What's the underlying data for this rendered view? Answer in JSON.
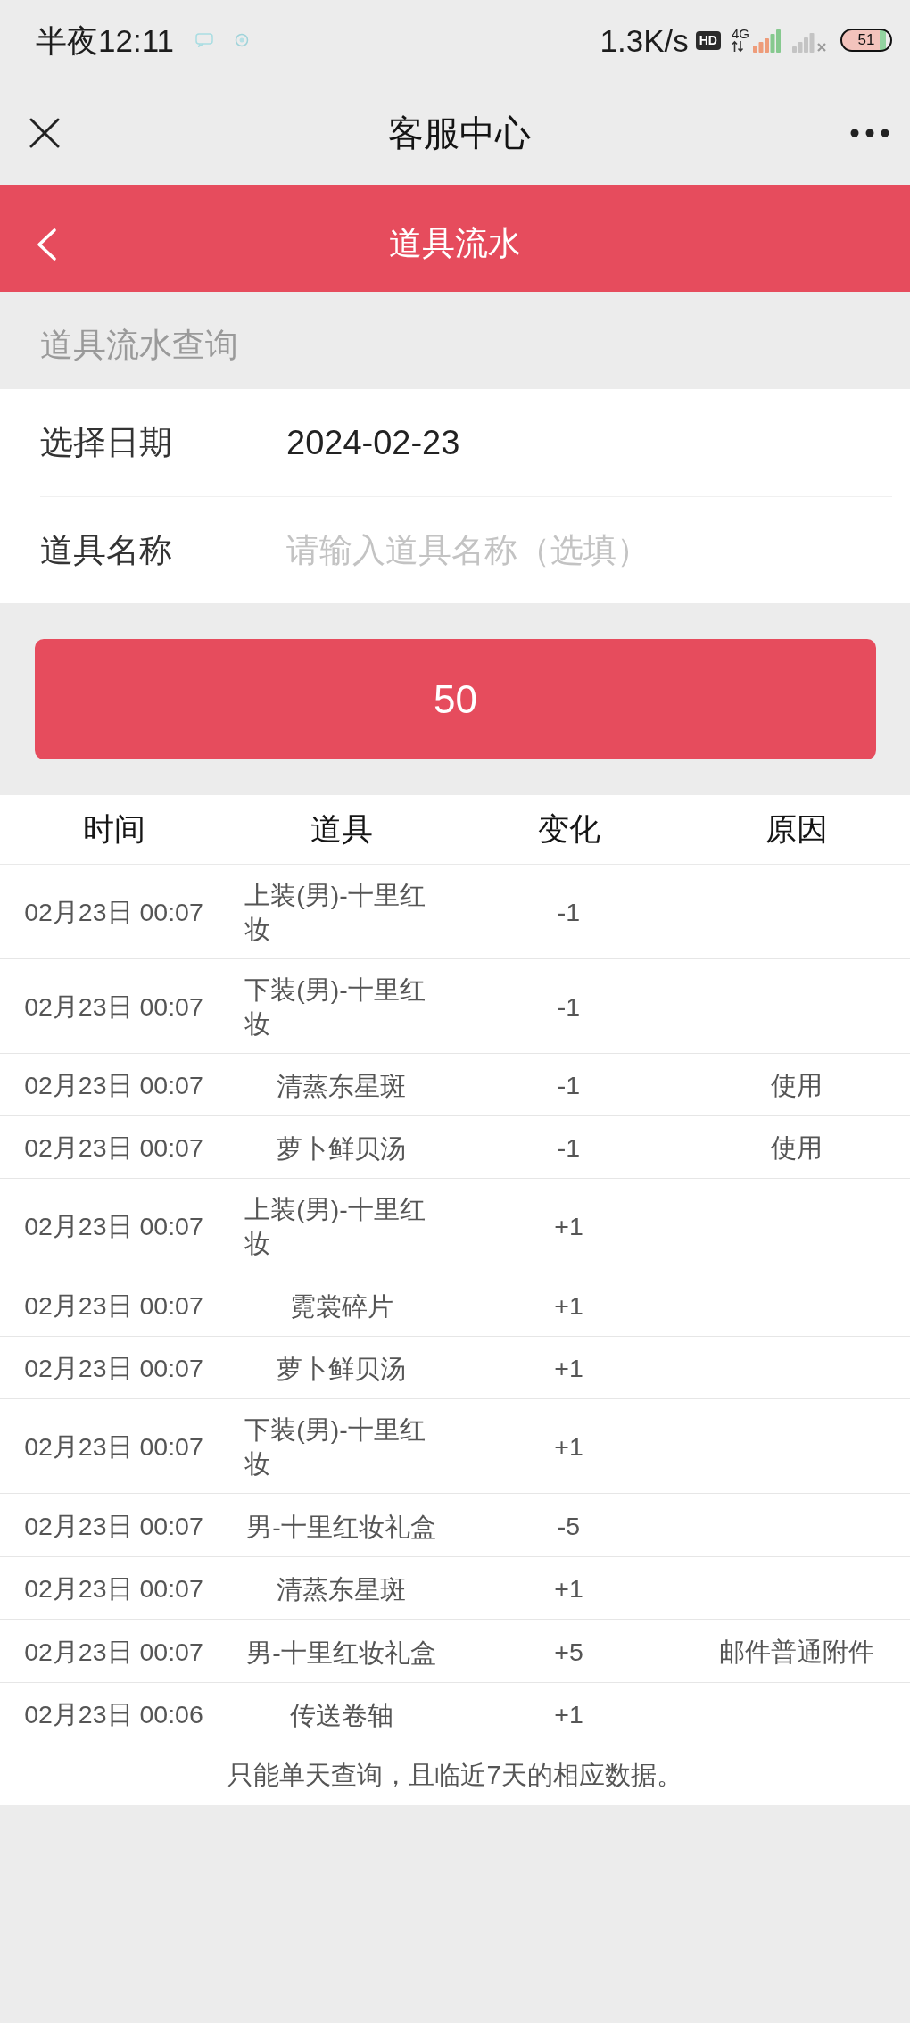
{
  "status_bar": {
    "time": "半夜12:11",
    "network_speed": "1.3K/s",
    "hd_badge": "HD",
    "network_type": "4G",
    "battery": "51"
  },
  "header": {
    "title": "客服中心"
  },
  "page_bar": {
    "title": "道具流水"
  },
  "query": {
    "section_title": "道具流水查询",
    "fields": [
      {
        "kind": "date",
        "label": "选择日期",
        "value": "2024-02-23"
      },
      {
        "kind": "text",
        "label": "道具名称",
        "placeholder": "请输入道具名称（选填）"
      }
    ],
    "submit_button": "50"
  },
  "table": {
    "columns": [
      "时间",
      "道具",
      "变化",
      "原因"
    ],
    "rows": [
      {
        "time": "02月23日 00:07",
        "item": "上装(男)-十里红妆",
        "change": "-1"
      },
      {
        "time": "02月23日 00:07",
        "item": "下装(男)-十里红妆",
        "change": "-1"
      },
      {
        "time": "02月23日 00:07",
        "item": "清蒸东星斑",
        "change": "-1",
        "reason": "使用"
      },
      {
        "time": "02月23日 00:07",
        "item": "萝卜鲜贝汤",
        "change": "-1",
        "reason": "使用"
      },
      {
        "time": "02月23日 00:07",
        "item": "上装(男)-十里红妆",
        "change": "+1"
      },
      {
        "time": "02月23日 00:07",
        "item": "霓裳碎片",
        "change": "+1"
      },
      {
        "time": "02月23日 00:07",
        "item": "萝卜鲜贝汤",
        "change": "+1"
      },
      {
        "time": "02月23日 00:07",
        "item": "下装(男)-十里红妆",
        "change": "+1"
      },
      {
        "time": "02月23日 00:07",
        "item": "男-十里红妆礼盒",
        "change": "-5"
      },
      {
        "time": "02月23日 00:07",
        "item": "清蒸东星斑",
        "change": "+1"
      },
      {
        "time": "02月23日 00:07",
        "item": "男-十里红妆礼盒",
        "change": "+5",
        "reason": "邮件普通附件"
      },
      {
        "time": "02月23日 00:06",
        "item": "传送卷轴",
        "change": "+1"
      }
    ]
  },
  "footer_note": "只能单天查询，且临近7天的相应数据。"
}
